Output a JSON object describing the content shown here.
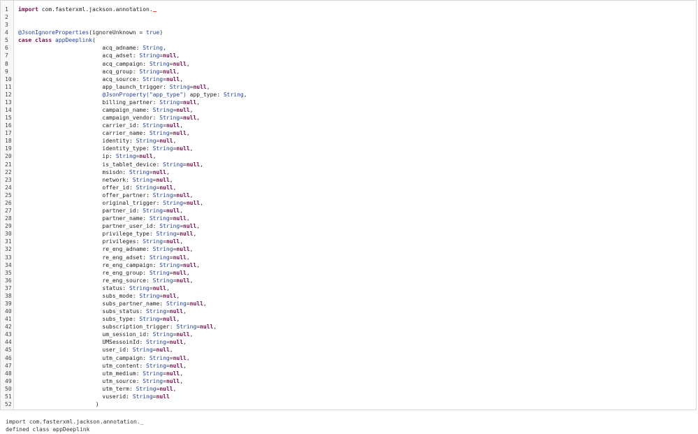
{
  "editor": {
    "lines": [
      [
        [
          "import",
          "kw"
        ],
        [
          " com.fasterxml.jackson.annotation.",
          "plain"
        ]
      ],
      [],
      [],
      [
        [
          "@JsonIgnoreProperties",
          "ann"
        ],
        [
          "(ignoreUnknown = ",
          "plain"
        ],
        [
          "true",
          "lit"
        ],
        [
          ")",
          "plain"
        ]
      ],
      [
        [
          "case",
          "kw"
        ],
        [
          " ",
          "plain"
        ],
        [
          "class",
          "kw"
        ],
        [
          " ",
          "plain"
        ],
        [
          "appDeeplink",
          "cls"
        ],
        [
          "(",
          "plain"
        ]
      ],
      [
        [
          "                         acq_adname: ",
          "plain"
        ],
        [
          "String",
          "type"
        ],
        [
          ",",
          "plain"
        ]
      ],
      [
        [
          "                         acq_adset: ",
          "plain"
        ],
        [
          "String",
          "type"
        ],
        [
          "=",
          "plain"
        ],
        [
          "null",
          "kw"
        ],
        [
          ",",
          "plain"
        ]
      ],
      [
        [
          "                         acq_campaign: ",
          "plain"
        ],
        [
          "String",
          "type"
        ],
        [
          "=",
          "plain"
        ],
        [
          "null",
          "kw"
        ],
        [
          ",",
          "plain"
        ]
      ],
      [
        [
          "                         acq_group: ",
          "plain"
        ],
        [
          "String",
          "type"
        ],
        [
          "=",
          "plain"
        ],
        [
          "null",
          "kw"
        ],
        [
          ",",
          "plain"
        ]
      ],
      [
        [
          "                         acq_source: ",
          "plain"
        ],
        [
          "String",
          "type"
        ],
        [
          "=",
          "plain"
        ],
        [
          "null",
          "kw"
        ],
        [
          ",",
          "plain"
        ]
      ],
      [
        [
          "                         app_launch_trigger: ",
          "plain"
        ],
        [
          "String",
          "type"
        ],
        [
          "=",
          "plain"
        ],
        [
          "null",
          "kw"
        ],
        [
          ",",
          "plain"
        ]
      ],
      [
        [
          "                         ",
          "plain"
        ],
        [
          "@JsonProperty(",
          "ann"
        ],
        [
          "\"app_type\"",
          "str"
        ],
        [
          ")",
          "ann"
        ],
        [
          " app_type: ",
          "plain"
        ],
        [
          "String",
          "type"
        ],
        [
          ",",
          "plain"
        ]
      ],
      [
        [
          "                         billing_partner: ",
          "plain"
        ],
        [
          "String",
          "type"
        ],
        [
          "=",
          "plain"
        ],
        [
          "null",
          "kw"
        ],
        [
          ",",
          "plain"
        ]
      ],
      [
        [
          "                         campaign_name: ",
          "plain"
        ],
        [
          "String",
          "type"
        ],
        [
          "=",
          "plain"
        ],
        [
          "null",
          "kw"
        ],
        [
          ",",
          "plain"
        ]
      ],
      [
        [
          "                         campaign_vendor: ",
          "plain"
        ],
        [
          "String",
          "type"
        ],
        [
          "=",
          "plain"
        ],
        [
          "null",
          "kw"
        ],
        [
          ",",
          "plain"
        ]
      ],
      [
        [
          "                         carrier_id: ",
          "plain"
        ],
        [
          "String",
          "type"
        ],
        [
          "=",
          "plain"
        ],
        [
          "null",
          "kw"
        ],
        [
          ",",
          "plain"
        ]
      ],
      [
        [
          "                         carrier_name: ",
          "plain"
        ],
        [
          "String",
          "type"
        ],
        [
          "=",
          "plain"
        ],
        [
          "null",
          "kw"
        ],
        [
          ",",
          "plain"
        ]
      ],
      [
        [
          "                         identity: ",
          "plain"
        ],
        [
          "String",
          "type"
        ],
        [
          "=",
          "plain"
        ],
        [
          "null",
          "kw"
        ],
        [
          ",",
          "plain"
        ]
      ],
      [
        [
          "                         identity_type: ",
          "plain"
        ],
        [
          "String",
          "type"
        ],
        [
          "=",
          "plain"
        ],
        [
          "null",
          "kw"
        ],
        [
          ",",
          "plain"
        ]
      ],
      [
        [
          "                         ip: ",
          "plain"
        ],
        [
          "String",
          "type"
        ],
        [
          "=",
          "plain"
        ],
        [
          "null",
          "kw"
        ],
        [
          ",",
          "plain"
        ]
      ],
      [
        [
          "                         is_tablet_device: ",
          "plain"
        ],
        [
          "String",
          "type"
        ],
        [
          "=",
          "plain"
        ],
        [
          "null",
          "kw"
        ],
        [
          ",",
          "plain"
        ]
      ],
      [
        [
          "                         msisdn: ",
          "plain"
        ],
        [
          "String",
          "type"
        ],
        [
          "=",
          "plain"
        ],
        [
          "null",
          "kw"
        ],
        [
          ",",
          "plain"
        ]
      ],
      [
        [
          "                         network: ",
          "plain"
        ],
        [
          "String",
          "type"
        ],
        [
          "=",
          "plain"
        ],
        [
          "null",
          "kw"
        ],
        [
          ",",
          "plain"
        ]
      ],
      [
        [
          "                         offer_id: ",
          "plain"
        ],
        [
          "String",
          "type"
        ],
        [
          "=",
          "plain"
        ],
        [
          "null",
          "kw"
        ],
        [
          ",",
          "plain"
        ]
      ],
      [
        [
          "                         offer_partner: ",
          "plain"
        ],
        [
          "String",
          "type"
        ],
        [
          "=",
          "plain"
        ],
        [
          "null",
          "kw"
        ],
        [
          ",",
          "plain"
        ]
      ],
      [
        [
          "                         original_trigger: ",
          "plain"
        ],
        [
          "String",
          "type"
        ],
        [
          "=",
          "plain"
        ],
        [
          "null",
          "kw"
        ],
        [
          ",",
          "plain"
        ]
      ],
      [
        [
          "                         partner_id: ",
          "plain"
        ],
        [
          "String",
          "type"
        ],
        [
          "=",
          "plain"
        ],
        [
          "null",
          "kw"
        ],
        [
          ",",
          "plain"
        ]
      ],
      [
        [
          "                         partner_name: ",
          "plain"
        ],
        [
          "String",
          "type"
        ],
        [
          "=",
          "plain"
        ],
        [
          "null",
          "kw"
        ],
        [
          ",",
          "plain"
        ]
      ],
      [
        [
          "                         partner_user_id: ",
          "plain"
        ],
        [
          "String",
          "type"
        ],
        [
          "=",
          "plain"
        ],
        [
          "null",
          "kw"
        ],
        [
          ",",
          "plain"
        ]
      ],
      [
        [
          "                         privilege_type: ",
          "plain"
        ],
        [
          "String",
          "type"
        ],
        [
          "=",
          "plain"
        ],
        [
          "null",
          "kw"
        ],
        [
          ",",
          "plain"
        ]
      ],
      [
        [
          "                         privileges: ",
          "plain"
        ],
        [
          "String",
          "type"
        ],
        [
          "=",
          "plain"
        ],
        [
          "null",
          "kw"
        ],
        [
          ",",
          "plain"
        ]
      ],
      [
        [
          "                         re_eng_adname: ",
          "plain"
        ],
        [
          "String",
          "type"
        ],
        [
          "=",
          "plain"
        ],
        [
          "null",
          "kw"
        ],
        [
          ",",
          "plain"
        ]
      ],
      [
        [
          "                         re_eng_adset: ",
          "plain"
        ],
        [
          "String",
          "type"
        ],
        [
          "=",
          "plain"
        ],
        [
          "null",
          "kw"
        ],
        [
          ",",
          "plain"
        ]
      ],
      [
        [
          "                         re_eng_campaign: ",
          "plain"
        ],
        [
          "String",
          "type"
        ],
        [
          "=",
          "plain"
        ],
        [
          "null",
          "kw"
        ],
        [
          ",",
          "plain"
        ]
      ],
      [
        [
          "                         re_eng_group: ",
          "plain"
        ],
        [
          "String",
          "type"
        ],
        [
          "=",
          "plain"
        ],
        [
          "null",
          "kw"
        ],
        [
          ",",
          "plain"
        ]
      ],
      [
        [
          "                         re_eng_source: ",
          "plain"
        ],
        [
          "String",
          "type"
        ],
        [
          "=",
          "plain"
        ],
        [
          "null",
          "kw"
        ],
        [
          ",",
          "plain"
        ]
      ],
      [
        [
          "                         status: ",
          "plain"
        ],
        [
          "String",
          "type"
        ],
        [
          "=",
          "plain"
        ],
        [
          "null",
          "kw"
        ],
        [
          ",",
          "plain"
        ]
      ],
      [
        [
          "                         subs_mode: ",
          "plain"
        ],
        [
          "String",
          "type"
        ],
        [
          "=",
          "plain"
        ],
        [
          "null",
          "kw"
        ],
        [
          ",",
          "plain"
        ]
      ],
      [
        [
          "                         subs_partner_name: ",
          "plain"
        ],
        [
          "String",
          "type"
        ],
        [
          "=",
          "plain"
        ],
        [
          "null",
          "kw"
        ],
        [
          ",",
          "plain"
        ]
      ],
      [
        [
          "                         subs_status: ",
          "plain"
        ],
        [
          "String",
          "type"
        ],
        [
          "=",
          "plain"
        ],
        [
          "null",
          "kw"
        ],
        [
          ",",
          "plain"
        ]
      ],
      [
        [
          "                         subs_type: ",
          "plain"
        ],
        [
          "String",
          "type"
        ],
        [
          "=",
          "plain"
        ],
        [
          "null",
          "kw"
        ],
        [
          ",",
          "plain"
        ]
      ],
      [
        [
          "                         subscription_trigger: ",
          "plain"
        ],
        [
          "String",
          "type"
        ],
        [
          "=",
          "plain"
        ],
        [
          "null",
          "kw"
        ],
        [
          ",",
          "plain"
        ]
      ],
      [
        [
          "                         um_session_id: ",
          "plain"
        ],
        [
          "String",
          "type"
        ],
        [
          "=",
          "plain"
        ],
        [
          "null",
          "kw"
        ],
        [
          ",",
          "plain"
        ]
      ],
      [
        [
          "                         UMSessoinId: ",
          "plain"
        ],
        [
          "String",
          "type"
        ],
        [
          "=",
          "plain"
        ],
        [
          "null",
          "kw"
        ],
        [
          ",",
          "plain"
        ]
      ],
      [
        [
          "                         user_id: ",
          "plain"
        ],
        [
          "String",
          "type"
        ],
        [
          "=",
          "plain"
        ],
        [
          "null",
          "kw"
        ],
        [
          ",",
          "plain"
        ]
      ],
      [
        [
          "                         utm_campaign: ",
          "plain"
        ],
        [
          "String",
          "type"
        ],
        [
          "=",
          "plain"
        ],
        [
          "null",
          "kw"
        ],
        [
          ",",
          "plain"
        ]
      ],
      [
        [
          "                         utm_content: ",
          "plain"
        ],
        [
          "String",
          "type"
        ],
        [
          "=",
          "plain"
        ],
        [
          "null",
          "kw"
        ],
        [
          ",",
          "plain"
        ]
      ],
      [
        [
          "                         utm_medium: ",
          "plain"
        ],
        [
          "String",
          "type"
        ],
        [
          "=",
          "plain"
        ],
        [
          "null",
          "kw"
        ],
        [
          ",",
          "plain"
        ]
      ],
      [
        [
          "                         utm_source: ",
          "plain"
        ],
        [
          "String",
          "type"
        ],
        [
          "=",
          "plain"
        ],
        [
          "null",
          "kw"
        ],
        [
          ",",
          "plain"
        ]
      ],
      [
        [
          "                         utm_term: ",
          "plain"
        ],
        [
          "String",
          "type"
        ],
        [
          "=",
          "plain"
        ],
        [
          "null",
          "kw"
        ],
        [
          ",",
          "plain"
        ]
      ],
      [
        [
          "                         vuserid: ",
          "plain"
        ],
        [
          "String",
          "type"
        ],
        [
          "=",
          "plain"
        ],
        [
          "null",
          "kw"
        ]
      ],
      [
        [
          "                       )",
          "plain"
        ]
      ]
    ],
    "cursor_line_index": 0
  },
  "output": {
    "lines": [
      "import com.fasterxml.jackson.annotation._",
      "defined class appDeeplink"
    ]
  },
  "colors": {
    "kw": "#7a0f4f",
    "type": "#1f3fa8",
    "ann": "#1f3fa8",
    "str": "#1f3fa8",
    "lit": "#1f3fa8",
    "cls": "#1f3fa8",
    "plain": "#222222",
    "line_number": "#444444"
  }
}
